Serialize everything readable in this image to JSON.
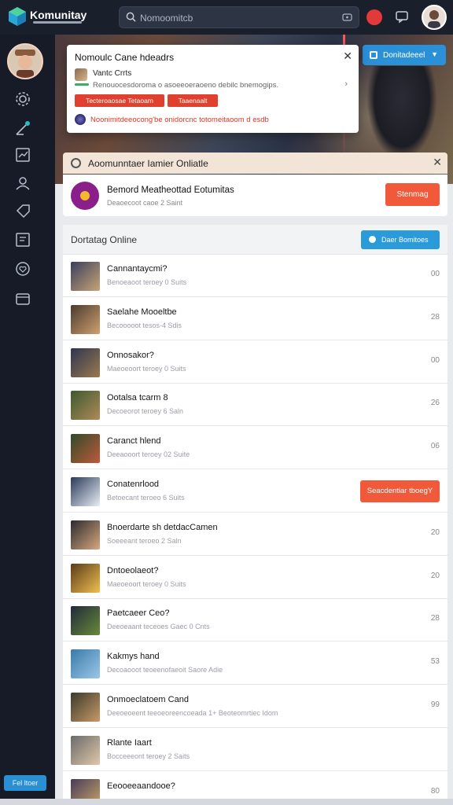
{
  "app": {
    "brand": "Komunitay"
  },
  "search": {
    "placeholder": "Nomoomitcb"
  },
  "topbar": {
    "icons": [
      "search-icon",
      "keyboard-icon",
      "notification-icon",
      "chat-icon",
      "avatar"
    ]
  },
  "sidebar": {
    "icons": [
      "gear-icon",
      "pen-icon",
      "chart-icon",
      "user-icon",
      "tag-icon",
      "list-icon",
      "heart-icon",
      "box-icon"
    ],
    "button_label": "Fel ltoer"
  },
  "dropdown": {
    "label": "Donitadeeel"
  },
  "popup": {
    "title": "Nomoulc Cane hdeadrs",
    "item_title": "Vantc Crrts",
    "item_desc": "Renouocesdoroma o asoeeoeraoeno debilc bnemogips.",
    "tag1": "Tecteroaosae Tetaoam",
    "tag2": "Taaenaalt",
    "warning": "Noonimitdeeocong'be onidorcnc totomeitaoom d esdb"
  },
  "announcement": {
    "text": "Aoomunntaer Iamier Onliatle"
  },
  "featured": {
    "name": "Bemord Meatheottad Eotumitas",
    "sub": "Deaoecoot caoe 2 Saint",
    "button": "Stenmag"
  },
  "online": {
    "title": "Dortatag Online",
    "button": "Daer Bomitoes",
    "rows": [
      {
        "name": "Cannantaycmi?",
        "sub": "Benoeaoot teroey 0 Suits",
        "num": "00",
        "thumb": [
          "#3a3f5c",
          "#c8a478"
        ]
      },
      {
        "name": "Saelahe Mooeltbe",
        "sub": "Becooooot tesos-4 Sdis",
        "num": "28",
        "thumb": [
          "#4a3b2e",
          "#d0a070"
        ]
      },
      {
        "name": "Onnosakor?",
        "sub": "Maeoeoort teroey 0 Suits",
        "num": "00",
        "thumb": [
          "#2f3450",
          "#9a7a4e"
        ]
      },
      {
        "name": "Ootalsa tcarm 8",
        "sub": "Decoeorot teroey 6 Saln",
        "num": "26",
        "thumb": [
          "#3c5a2e",
          "#b08a58"
        ]
      },
      {
        "name": "Caranct hlend",
        "sub": "Deeaooort teroey 02 Suite",
        "num": "06",
        "thumb": [
          "#2e4a2a",
          "#c05a3a"
        ]
      },
      {
        "name": "Conatenrlood",
        "sub": "Betoecant teroeo 6 Suits",
        "num": "",
        "button": "Seacdentiar tboegY",
        "thumb": [
          "#2a3a5a",
          "#e8eef4"
        ]
      },
      {
        "name": "Bnoerdarte sh detdacCamen",
        "sub": "Soeeeant teroeo 2 Saln",
        "num": "20",
        "thumb": [
          "#2a2a2e",
          "#d8a880"
        ]
      },
      {
        "name": "Dntoeolaeot?",
        "sub": "Maeoeoort teroey 0 Suits",
        "num": "20",
        "thumb": [
          "#5a3a1a",
          "#f0c050"
        ]
      },
      {
        "name": "Paetcaeer Ceo?",
        "sub": "Deeoeaant teceoes Gaec 0 Cnts",
        "num": "28",
        "thumb": [
          "#1f2a3a",
          "#6a8a3a"
        ]
      },
      {
        "name": "Kakmys hand",
        "sub": "Decoaooot teoeenofaeoit Saore Adie",
        "num": "53",
        "thumb": [
          "#3a7aa8",
          "#9ac8e8"
        ]
      },
      {
        "name": "Onmoeclatoem Cand",
        "sub": "Deeoeoeent teeoeoreencoeada 1+ Beoteomrtiec Idom",
        "num": "99",
        "thumb": [
          "#3a3a2a",
          "#c89a68"
        ]
      },
      {
        "name": "Rlante Iaart",
        "sub": "Bocceeeont teroey 2 Saits",
        "num": "",
        "thumb": [
          "#6a6a6a",
          "#e0c8a8"
        ]
      },
      {
        "name": "Eeooeeaandooe?",
        "sub": "",
        "num": "80",
        "thumb": [
          "#4a3a5a",
          "#c8a868"
        ]
      }
    ]
  }
}
